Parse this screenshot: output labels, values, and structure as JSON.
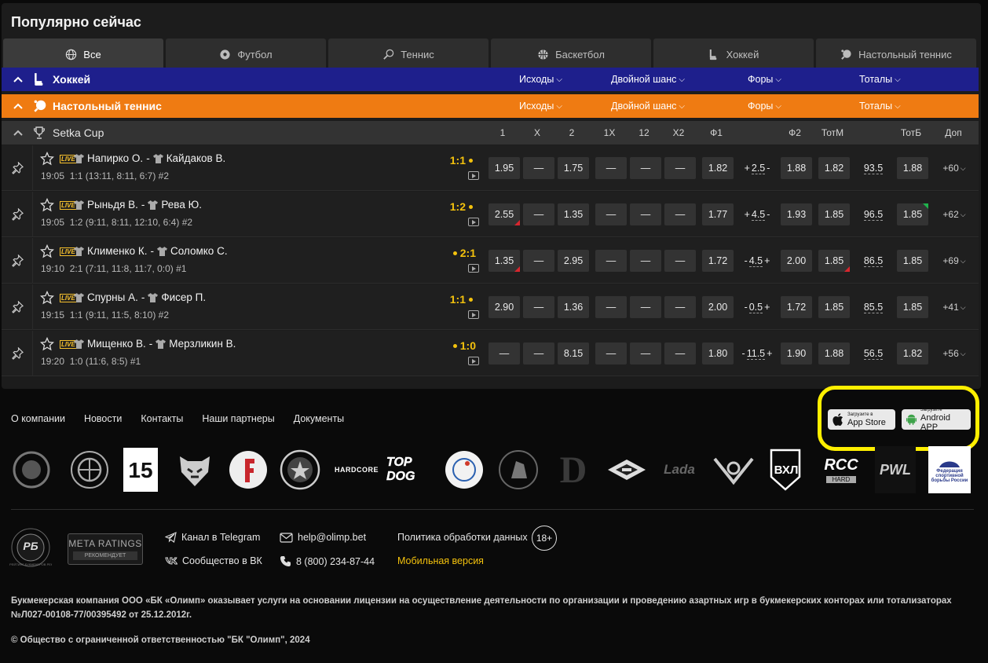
{
  "popular": {
    "title": "Популярно сейчас",
    "tabs": [
      {
        "label": "Все",
        "icon": "globe-icon",
        "active": true
      },
      {
        "label": "Футбол",
        "icon": "soccer-ball-icon"
      },
      {
        "label": "Теннис",
        "icon": "tennis-icon"
      },
      {
        "label": "Баскетбол",
        "icon": "basketball-icon"
      },
      {
        "label": "Хоккей",
        "icon": "hockey-icon"
      },
      {
        "label": "Настольный теннис",
        "icon": "table-tennis-icon"
      }
    ],
    "categories": [
      {
        "name": "Хоккей",
        "color": "#1e1f8c",
        "markets": [
          "Исходы",
          "Двойной шанс",
          "Форы",
          "Тоталы"
        ]
      },
      {
        "name": "Настольный теннис",
        "color": "#ef7b12",
        "markets": [
          "Исходы",
          "Двойной шанс",
          "Форы",
          "Тоталы"
        ]
      }
    ],
    "league": {
      "name": "Setka Cup",
      "columns": [
        "1",
        "X",
        "2",
        "1X",
        "12",
        "X2",
        "Ф1",
        "Ф2",
        "ТотМ",
        "ТотБ",
        "Доп"
      ]
    },
    "matches": [
      {
        "home": "Напирко О.",
        "away": "Кайдаков В.",
        "time": "19:05",
        "details": "1:1 (13:11, 8:11, 6:7) #2",
        "score": "1:1",
        "serve": "after",
        "odds": [
          "1.95",
          "—",
          "1.75",
          "—",
          "—",
          "—",
          "1.82"
        ],
        "hcap_sign_l": "+",
        "hcap": "2.5",
        "hcap_sign_r": "-",
        "f2": "1.88",
        "totm": "1.82",
        "total": "93.5",
        "totb": "1.88",
        "more": "+60"
      },
      {
        "home": "Рыньдя В.",
        "away": "Рева Ю.",
        "time": "19:05",
        "details": "1:2 (9:11, 8:11, 12:10, 6:4) #2",
        "score": "1:2",
        "serve": "after",
        "odds": [
          "2.55",
          "—",
          "1.35",
          "—",
          "—",
          "—",
          "1.77"
        ],
        "hcap_sign_l": "+",
        "hcap": "4.5",
        "hcap_sign_r": "-",
        "f2": "1.93",
        "totm": "1.85",
        "total": "96.5",
        "totb": "1.85",
        "more": "+62"
      },
      {
        "home": "Клименко К.",
        "away": "Соломко С.",
        "time": "19:10",
        "details": "2:1 (7:11, 11:8, 11:7, 0:0) #1",
        "score": "2:1",
        "serve": "before",
        "odds": [
          "1.35",
          "—",
          "2.95",
          "—",
          "—",
          "—",
          "1.72"
        ],
        "hcap_sign_l": "-",
        "hcap": "4.5",
        "hcap_sign_r": "+",
        "f2": "2.00",
        "totm": "1.85",
        "total": "86.5",
        "totb": "1.85",
        "more": "+69"
      },
      {
        "home": "Спурны А.",
        "away": "Фисер П.",
        "time": "19:15",
        "details": "1:1 (9:11, 11:5, 8:10) #2",
        "score": "1:1",
        "serve": "after",
        "odds": [
          "2.90",
          "—",
          "1.36",
          "—",
          "—",
          "—",
          "2.00"
        ],
        "hcap_sign_l": "-",
        "hcap": "0.5",
        "hcap_sign_r": "+",
        "f2": "1.72",
        "totm": "1.85",
        "total": "85.5",
        "totb": "1.85",
        "more": "+41"
      },
      {
        "home": "Мищенко В.",
        "away": "Мерзликин В.",
        "time": "19:20",
        "details": "1:0 (11:6, 8:5) #1",
        "score": "1:0",
        "serve": "before",
        "odds": [
          "—",
          "—",
          "8.15",
          "—",
          "—",
          "—",
          "1.80"
        ],
        "hcap_sign_l": "-",
        "hcap": "11.5",
        "hcap_sign_r": "+",
        "f2": "1.90",
        "totm": "1.88",
        "total": "56.5",
        "totb": "1.82",
        "more": "+56"
      }
    ]
  },
  "footer": {
    "links": [
      "О компании",
      "Новости",
      "Контакты",
      "Наши партнеры",
      "Документы"
    ],
    "app_store": {
      "small": "Загрузите в",
      "big": "App Store"
    },
    "android": {
      "small": "Загрузите",
      "big": "Android APP"
    },
    "partner_labels": [
      "HARDCORE",
      "TOP DOG",
      "ВХЛ",
      "RCC",
      "HARD",
      "PWL",
      "Федерация спортивной борьбы России",
      "Lada"
    ],
    "badges": {
      "rb": "РБ",
      "rb_ring": "РЕЙТИНГ БУКМЕКЕРОВ РЕКОМЕНДУЕТ",
      "meta_top": "META RATINGS",
      "meta_bottom": "РЕКОМЕНДУЕТ"
    },
    "telegram": "Канал в Telegram",
    "vk": "Сообщество в ВК",
    "email": "help@olimp.bet",
    "phone": "8 (800) 234-87-44",
    "policy": "Политика обработки данных",
    "age": "18+",
    "mobile": "Мобильная версия",
    "legal": "Букмекерская компания ООО «БК «Олимп» оказывает услуги на основании лицензии на осуществление деятельности по организации и проведению азартных игр в букмекерских конторах или тотализаторах №Л027-00108-77/00395492 от 25.12.2012г.",
    "copyright": "© Общество с ограниченной ответственностью \"БК \"Олимп\", 2024"
  },
  "colors": {
    "accent_yellow": "#f4c20d",
    "highlight": "#ffef00",
    "hockey": "#1e1f8c",
    "table_tennis": "#ef7b12"
  }
}
